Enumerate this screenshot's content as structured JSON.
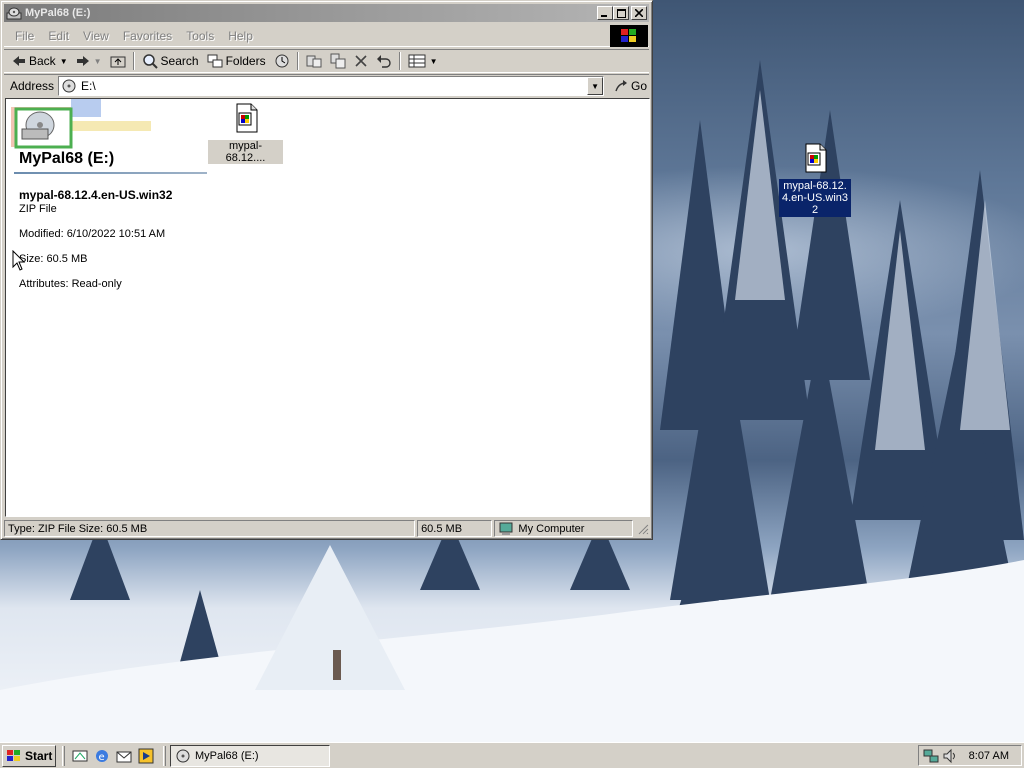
{
  "window": {
    "title": "MyPal68 (E:)",
    "buttons": {
      "minimize": "_",
      "maximize": "□",
      "close": "×"
    }
  },
  "menu": [
    "File",
    "Edit",
    "View",
    "Favorites",
    "Tools",
    "Help"
  ],
  "toolbar": {
    "back": "Back",
    "search": "Search",
    "folders": "Folders"
  },
  "address": {
    "label": "Address",
    "value": "E:\\",
    "go": "Go"
  },
  "info": {
    "drive_title": "MyPal68 (E:)",
    "selected_name": "mypal-68.12.4.en-US.win32",
    "selected_type": "ZIP File",
    "modified": "Modified: 6/10/2022 10:51 AM",
    "size": "Size: 60.5 MB",
    "attributes": "Attributes: Read-only"
  },
  "files": [
    {
      "name": "mypal-68.12....",
      "icon": "zip-file-icon"
    }
  ],
  "status": {
    "text": "Type: ZIP File Size: 60.5 MB",
    "size": "60.5 MB",
    "zone": "My Computer"
  },
  "desktop_icon": {
    "name": "mypal-68.12.4.en-US.win32",
    "icon": "zip-file-icon"
  },
  "taskbar": {
    "start": "Start",
    "task": "MyPal68 (E:)",
    "clock": "8:07 AM"
  },
  "colors": {
    "selection": "#0a246a",
    "face": "#d4d0c8",
    "title_inactive": "#7b7b7b"
  }
}
